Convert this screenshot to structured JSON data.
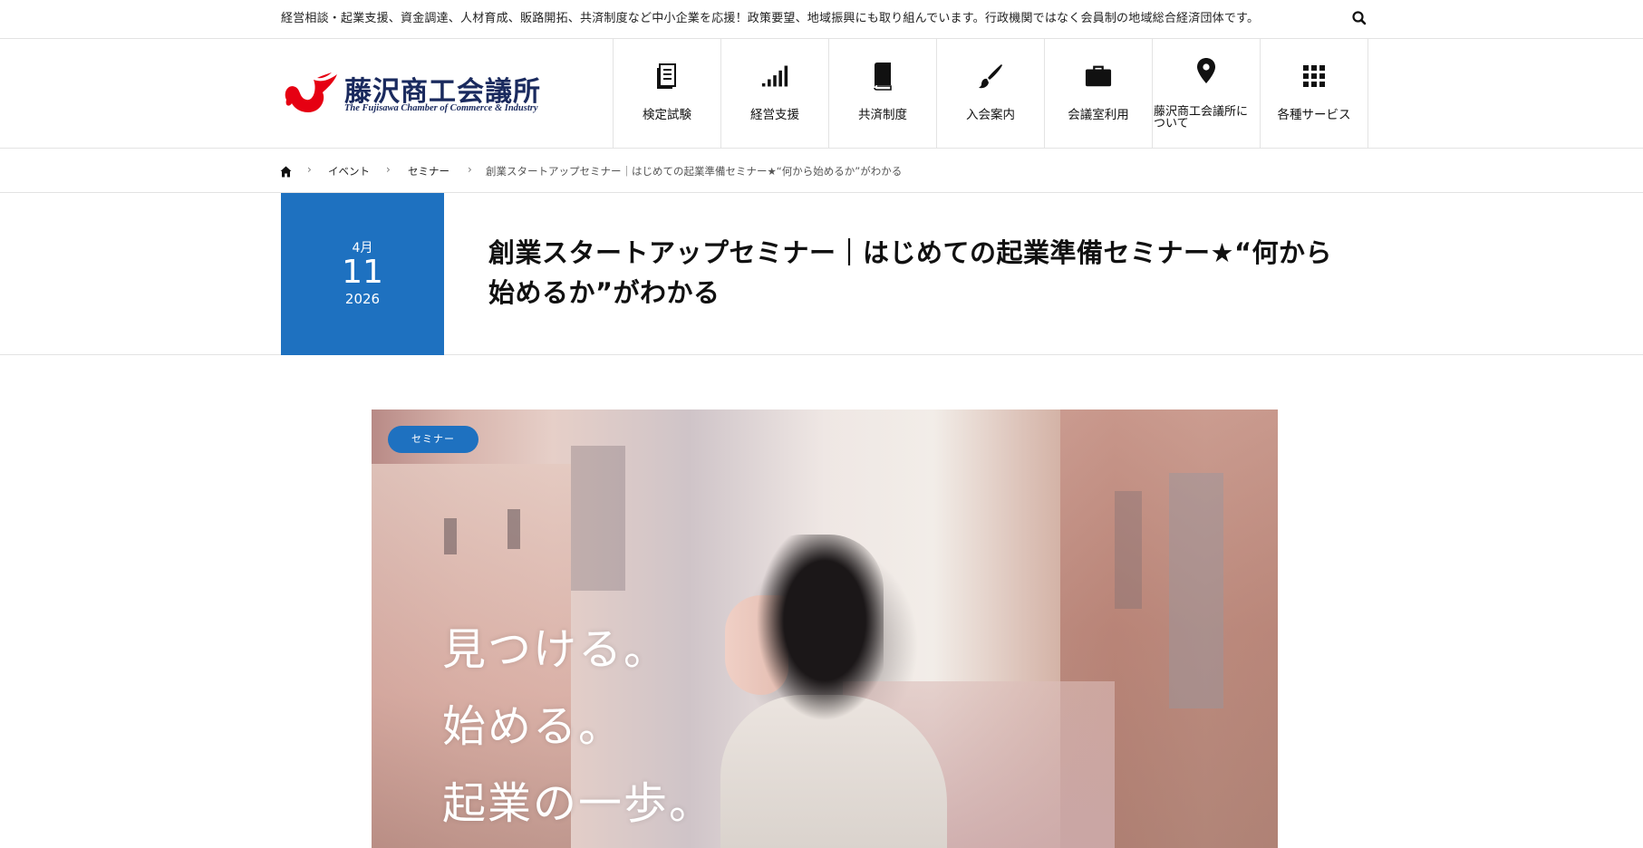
{
  "topbar": {
    "text": "経営相談・起業支援、資金調達、人材育成、販路開拓、共済制度など中小企業を応援！政策要望、地域振興にも取り組んでいます。行政機関ではなく会員制の地域総合経済団体です。",
    "search_icon": "search-icon"
  },
  "header": {
    "logo_name": "藤沢商工会議所",
    "logo_sub": "The Fujisawa Chamber of Commerce & Industry",
    "nav": [
      {
        "label": "検定試験",
        "icon": "document-icon"
      },
      {
        "label": "経営支援",
        "icon": "signal-bars-icon"
      },
      {
        "label": "共済制度",
        "icon": "book-icon"
      },
      {
        "label": "入会案内",
        "icon": "brush-icon"
      },
      {
        "label": "会議室利用",
        "icon": "briefcase-icon"
      },
      {
        "label": "藤沢商工会議所について",
        "label_line1": "藤沢商工会議所に",
        "label_line2": "ついて",
        "icon": "map-pin-icon"
      },
      {
        "label": "各種サービス",
        "icon": "grid-icon"
      }
    ]
  },
  "breadcrumb": {
    "home_icon": "home-icon",
    "items": [
      "イベント",
      "セミナー"
    ],
    "current": "創業スタートアップセミナー｜はじめての起業準備セミナー★“何から始めるか”がわかる"
  },
  "event": {
    "month": "4月",
    "day": "11",
    "year": "2026",
    "title": "創業スタートアップセミナー｜はじめての起業準備セミナー★“何から始めるか”がわかる"
  },
  "hero": {
    "category": "セミナー",
    "copy": [
      "見つける。",
      "始める。",
      "起業の一歩。"
    ]
  },
  "colors": {
    "accent": "#1e71c0",
    "logo_navy": "#1a2a5e",
    "logo_red": "#e60012"
  }
}
